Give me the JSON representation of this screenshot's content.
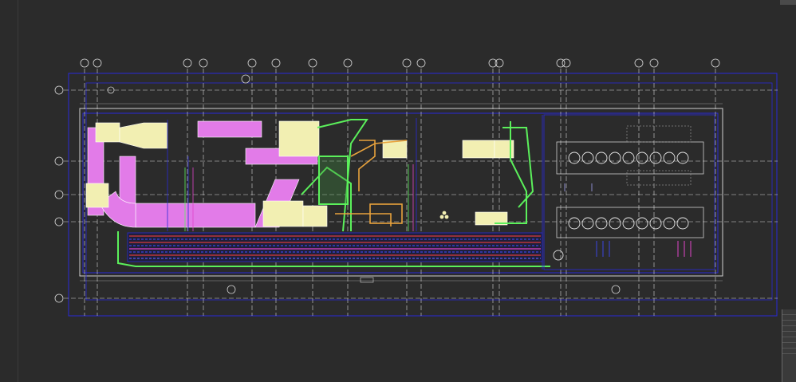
{
  "app": {
    "view": "cad-drawing-viewport"
  },
  "colors": {
    "background": "#2b2b2b",
    "gridline": "#d8d8d8",
    "outline": "#2a2ad8",
    "duct_magenta": "#e27be8",
    "duct_yellow": "#f2efb2",
    "duct_green": "#5bf05b",
    "duct_orange": "#e8a23c",
    "pipe_red": "#d63a3a",
    "pipe_blue": "#3b44e0",
    "equipment": "#d9d9d9"
  },
  "grid": {
    "vertical_bubbles": [
      "",
      "",
      "",
      "",
      "",
      "",
      "",
      "",
      "",
      "",
      "",
      "",
      "",
      "",
      "",
      ""
    ],
    "horizontal_bubbles": [
      "",
      "",
      "",
      "",
      ""
    ]
  },
  "equipment": {
    "units_row_1": 9,
    "units_row_2": 9
  }
}
